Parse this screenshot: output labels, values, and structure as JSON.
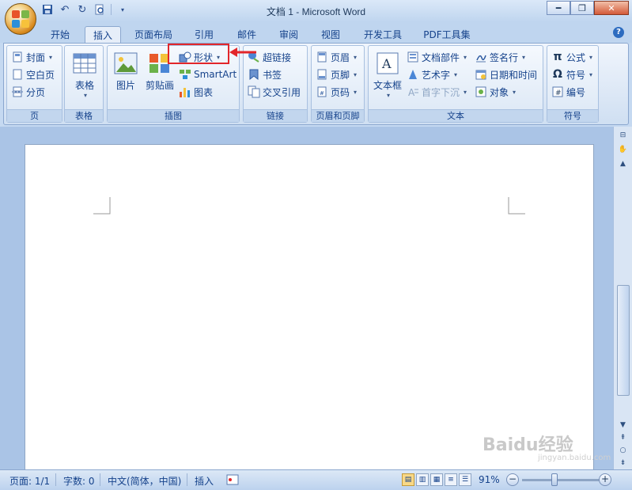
{
  "window": {
    "title": "文档 1 - Microsoft Word"
  },
  "quick_access": [
    "save-icon",
    "undo-icon",
    "redo-icon",
    "print-preview-icon",
    "customize-dropdown-icon"
  ],
  "tabs": [
    {
      "label": "开始"
    },
    {
      "label": "插入"
    },
    {
      "label": "页面布局"
    },
    {
      "label": "引用"
    },
    {
      "label": "邮件"
    },
    {
      "label": "审阅"
    },
    {
      "label": "视图"
    },
    {
      "label": "开发工具"
    },
    {
      "label": "PDF工具集"
    }
  ],
  "active_tab": "插入",
  "ribbon": {
    "pages": {
      "label": "页",
      "items": [
        "封面",
        "空白页",
        "分页"
      ]
    },
    "tables": {
      "label": "表格",
      "table": "表格"
    },
    "illustrations": {
      "label": "插图",
      "picture": "图片",
      "clipart": "剪贴画",
      "shapes": "形状",
      "smartart": "SmartArt",
      "chart": "图表"
    },
    "links": {
      "label": "链接",
      "items": [
        "超链接",
        "书签",
        "交叉引用"
      ]
    },
    "header_footer": {
      "label": "页眉和页脚",
      "items": [
        "页眉",
        "页脚",
        "页码"
      ]
    },
    "text": {
      "label": "文本",
      "textbox": "文本框",
      "quickparts": "文档部件",
      "wordart": "艺术字",
      "dropcap": "首字下沉",
      "signature": "签名行",
      "datetime": "日期和时间",
      "object": "对象"
    },
    "symbols": {
      "label": "符号",
      "items": [
        "公式",
        "符号",
        "编号"
      ]
    }
  },
  "status": {
    "page": "页面: 1/1",
    "words": "字数: 0",
    "language": "中文(简体，中国)",
    "mode": "插入",
    "zoom": "91%"
  },
  "watermark": {
    "text": "Baidu经验",
    "sub": "jingyan.baidu.com"
  },
  "colors": {
    "highlight": "#e2262a",
    "ribbon_bg": "#dde8f6",
    "titlebar": "#bfd5ef"
  }
}
